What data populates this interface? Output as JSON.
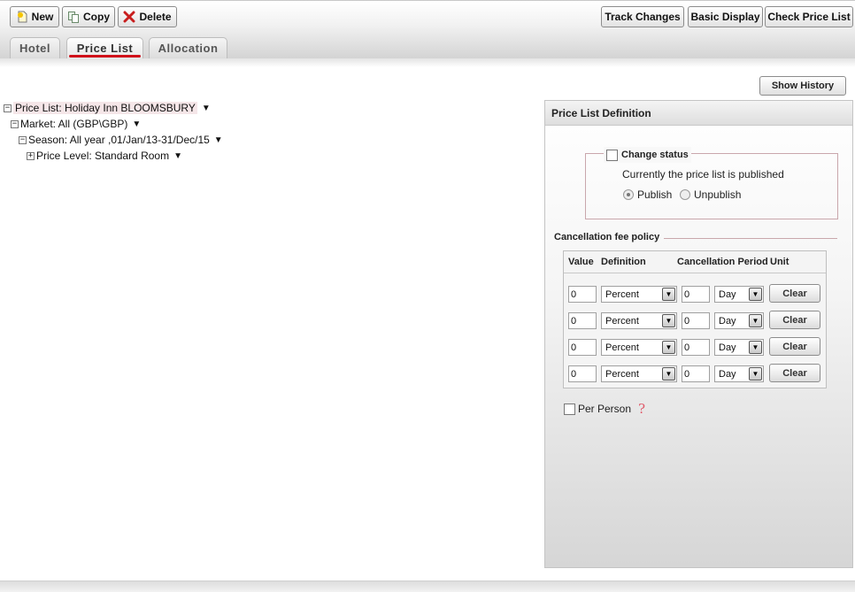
{
  "toolbar": {
    "new_label": "New",
    "copy_label": "Copy",
    "delete_label": "Delete",
    "track_changes_label": "Track Changes",
    "basic_display_label": "Basic Display",
    "check_price_list_label": "Check Price List"
  },
  "tabs": [
    {
      "label": "Hotel"
    },
    {
      "label": "Price List",
      "active": true
    },
    {
      "label": "Allocation"
    }
  ],
  "tree": {
    "price_list": "Price List: Holiday Inn BLOOMSBURY",
    "market": "Market: All (GBP\\GBP)",
    "season": "Season: All year ,01/Jan/13-31/Dec/15",
    "price_level": "Price Level: Standard Room",
    "expanded_symbol": "−",
    "collapsed_symbol": "+",
    "caret": "▼"
  },
  "history_button": "Show History",
  "panel": {
    "title": "Price List Definition",
    "change_status_label": "Change status",
    "status_text": "Currently the price list is published",
    "publish_label": "Publish",
    "unpublish_label": "Unpublish",
    "publish_selected": true,
    "cancellation_title": "Cancellation fee policy",
    "columns": {
      "value": "Value",
      "definition": "Definition",
      "period": "Cancellation Period",
      "unit": "Unit"
    },
    "rows": [
      {
        "value": "0",
        "definition": "Percent",
        "period": "0",
        "unit": "Day",
        "clear": "Clear"
      },
      {
        "value": "0",
        "definition": "Percent",
        "period": "0",
        "unit": "Day",
        "clear": "Clear"
      },
      {
        "value": "0",
        "definition": "Percent",
        "period": "0",
        "unit": "Day",
        "clear": "Clear"
      },
      {
        "value": "0",
        "definition": "Percent",
        "period": "0",
        "unit": "Day",
        "clear": "Clear"
      }
    ],
    "per_person_label": "Per Person",
    "help_glyph": "?"
  },
  "colors": {
    "tab_underline": "#d0101a",
    "fieldset_border": "#c9a7ac",
    "help_icon": "#e05a6a"
  }
}
